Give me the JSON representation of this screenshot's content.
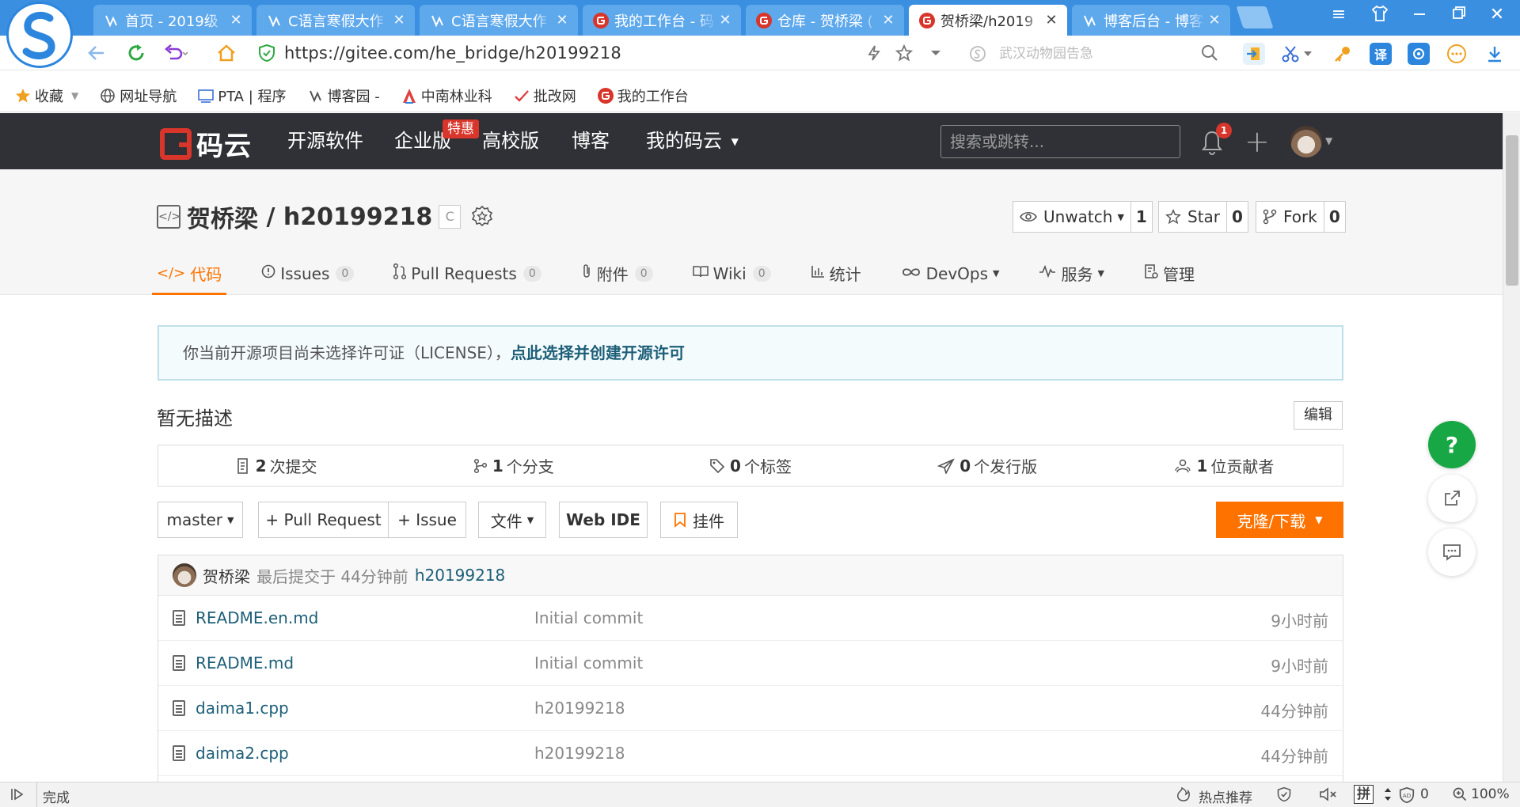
{
  "browser": {
    "tabs": [
      {
        "title": "首页 - 2019级",
        "icon": "blog-icon",
        "active": false
      },
      {
        "title": "C语言寒假大作",
        "icon": "blog-icon",
        "active": false
      },
      {
        "title": "C语言寒假大作",
        "icon": "blog-icon",
        "active": false
      },
      {
        "title": "我的工作台 - 码",
        "icon": "gitee-icon",
        "active": false
      },
      {
        "title": "仓库 - 贺桥梁 (",
        "icon": "gitee-icon",
        "active": false
      },
      {
        "title": "贺桥梁/h2019",
        "icon": "gitee-icon",
        "active": true
      },
      {
        "title": "博客后台 - 博客",
        "icon": "blog-icon",
        "active": false
      }
    ],
    "tab_close": "✕",
    "url_scheme": "https://",
    "url_host": "gitee.com",
    "url_path": "/he_bridge/h20199218",
    "search_placeholder": "武汉动物园告急",
    "bookmarks": [
      {
        "label": "收藏",
        "icon": "star-icon"
      },
      {
        "label": "网址导航",
        "icon": "globe-icon"
      },
      {
        "label": "PTA | 程序",
        "icon": "pta-icon"
      },
      {
        "label": "博客园 -",
        "icon": "blog-icon"
      },
      {
        "label": "中南林业科",
        "icon": "university-icon"
      },
      {
        "label": "批改网",
        "icon": "check-icon"
      },
      {
        "label": "我的工作台",
        "icon": "gitee-icon"
      }
    ],
    "status_text": "完成",
    "status_hot": "热点推荐",
    "status_ime": "拼",
    "status_count": "0",
    "status_zoom": "100%"
  },
  "gitee": {
    "logo_text": "码云",
    "nav": [
      "开源软件",
      "企业版",
      "高校版",
      "博客",
      "我的码云"
    ],
    "hot_badge": "特惠",
    "search_placeholder": "搜索或跳转...",
    "notification_count": "1",
    "colors": {
      "brand": "#d8352b",
      "accent": "#fe7300",
      "header_bg": "#2f3137",
      "link": "#1d5f78",
      "help": "#17a745"
    }
  },
  "repo": {
    "owner": "贺桥梁",
    "separator": " / ",
    "name": "h20199218",
    "lang_tag": "C",
    "watch_label": "Unwatch",
    "watch_count": "1",
    "star_label": "Star",
    "star_count": "0",
    "fork_label": "Fork",
    "fork_count": "0",
    "tabs": [
      {
        "label": "代码",
        "count": null,
        "active": true
      },
      {
        "label": "Issues",
        "count": "0"
      },
      {
        "label": "Pull Requests",
        "count": "0"
      },
      {
        "label": "附件",
        "count": "0"
      },
      {
        "label": "Wiki",
        "count": "0"
      },
      {
        "label": "统计",
        "count": null
      },
      {
        "label": "DevOps",
        "count": null
      },
      {
        "label": "服务",
        "count": null
      },
      {
        "label": "管理",
        "count": null
      }
    ],
    "license_notice": "你当前开源项目尚未选择许可证（LICENSE），",
    "license_link": "点此选择并创建开源许可",
    "description": "暂无描述",
    "edit_label": "编辑",
    "stats": [
      {
        "value": "2",
        "label": "次提交"
      },
      {
        "value": "1",
        "label": "个分支"
      },
      {
        "value": "0",
        "label": "个标签"
      },
      {
        "value": "0",
        "label": "个发行版"
      },
      {
        "value": "1",
        "label": "位贡献者"
      }
    ],
    "branch": "master",
    "pr_button": "+ Pull Request",
    "issue_button": "+ Issue",
    "file_button": "文件",
    "webide_button": "Web IDE",
    "widget_button": "挂件",
    "clone_button": "克隆/下载",
    "last_commit": {
      "author": "贺桥梁",
      "text": "最后提交于 44分钟前",
      "hash": "h20199218"
    },
    "files": [
      {
        "name": "README.en.md",
        "message": "Initial commit",
        "time": "9小时前"
      },
      {
        "name": "README.md",
        "message": "Initial commit",
        "time": "9小时前"
      },
      {
        "name": "daima1.cpp",
        "message": "h20199218",
        "time": "44分钟前"
      },
      {
        "name": "daima2.cpp",
        "message": "h20199218",
        "time": "44分钟前"
      }
    ],
    "help_label": "?"
  }
}
